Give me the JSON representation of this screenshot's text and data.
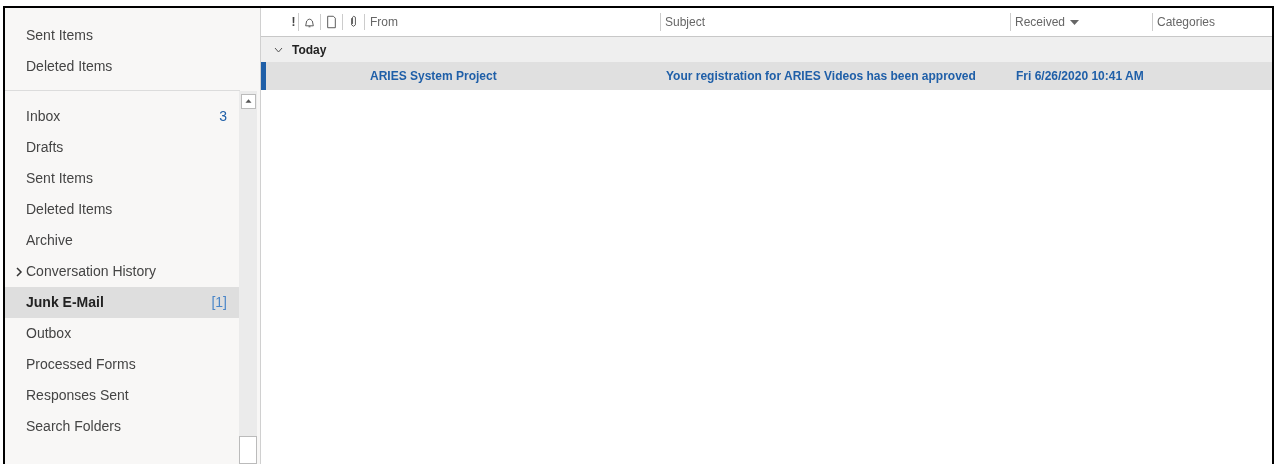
{
  "favorites": [
    {
      "name": "Sent Items",
      "selected": false,
      "expandable": false
    },
    {
      "name": "Deleted Items",
      "selected": false,
      "expandable": false
    }
  ],
  "folders": [
    {
      "name": "Inbox",
      "count": "3",
      "unread_count": true,
      "selected": false,
      "expandable": false
    },
    {
      "name": "Drafts",
      "selected": false,
      "expandable": false
    },
    {
      "name": "Sent Items",
      "selected": false,
      "expandable": false
    },
    {
      "name": "Deleted Items",
      "selected": false,
      "expandable": false
    },
    {
      "name": "Archive",
      "selected": false,
      "expandable": false
    },
    {
      "name": "Conversation History",
      "selected": false,
      "expandable": true
    },
    {
      "name": "Junk E-Mail",
      "count": "[1]",
      "unread_count": false,
      "selected": true,
      "expandable": false
    },
    {
      "name": "Outbox",
      "selected": false,
      "expandable": false
    },
    {
      "name": "Processed Forms",
      "selected": false,
      "expandable": false
    },
    {
      "name": "Responses Sent",
      "selected": false,
      "expandable": false
    },
    {
      "name": "Search Folders",
      "selected": false,
      "expandable": false
    }
  ],
  "columns": {
    "importance": "!",
    "from": "From",
    "subject": "Subject",
    "received": "Received",
    "categories": "Categories"
  },
  "groups": [
    {
      "label": "Today",
      "expanded": true,
      "messages": [
        {
          "from": "ARIES System Project",
          "subject": "Your registration for ARIES Videos has been approved",
          "received": "Fri 6/26/2020 10:41 AM",
          "unread": true,
          "selected": true
        }
      ]
    }
  ]
}
